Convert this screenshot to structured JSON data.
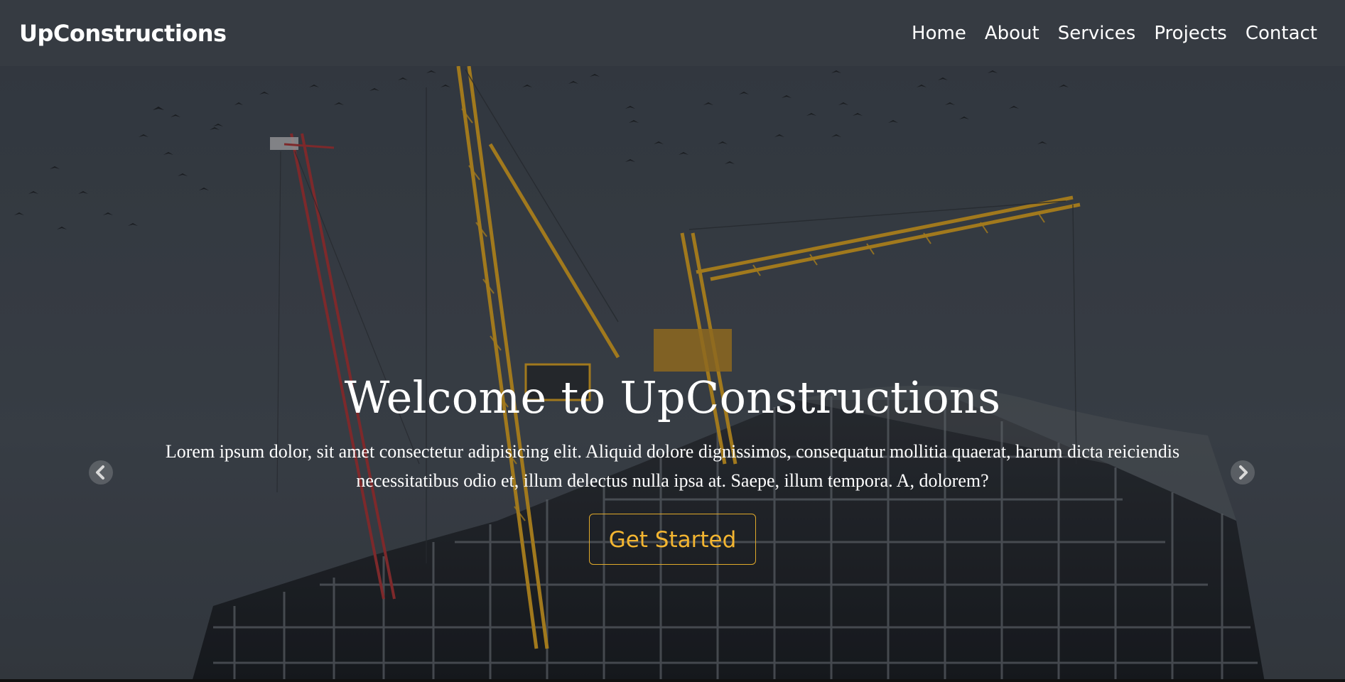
{
  "navbar": {
    "brand": "UpConstructions",
    "links": [
      "Home",
      "About",
      "Services",
      "Projects",
      "Contact"
    ]
  },
  "hero": {
    "title": "Welcome to UpConstructions",
    "text": "Lorem ipsum dolor, sit amet consectetur adipisicing elit. Aliquid dolore dignissimos, consequatur mollitia quaerat, harum dicta reiciendis necessitatibus odio et, illum delectus nulla ipsa at. Saepe, illum tempora. A, dolorem?",
    "cta_label": "Get Started",
    "prev_icon": "chevron-left-icon",
    "next_icon": "chevron-right-icon"
  },
  "colors": {
    "navbar_bg": "#363b42",
    "accent": "#f3b531",
    "crane_yellow": "#c9951d",
    "crane_red": "#9c2f2f"
  }
}
